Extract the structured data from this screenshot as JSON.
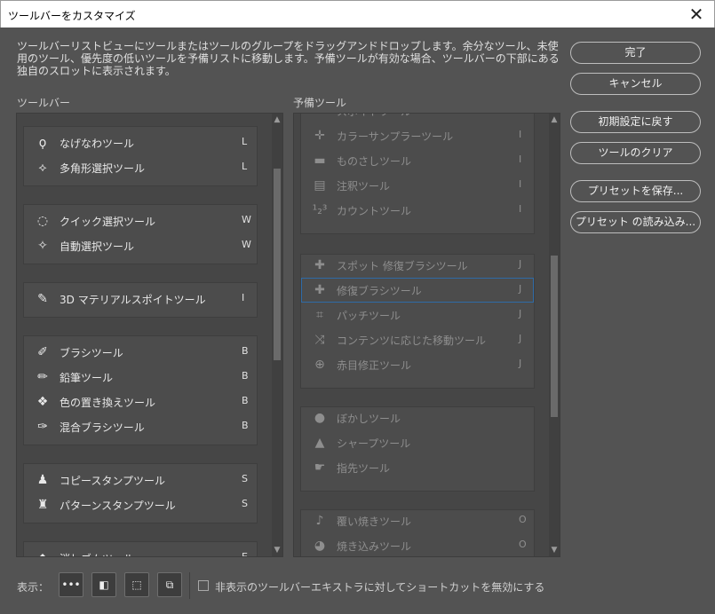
{
  "window": {
    "title": "ツールバーをカスタマイズ",
    "close_glyph": "✕"
  },
  "description": "ツールバーリストビューにツールまたはツールのグループをドラッグアンドドロップします。余分なツール、未使用のツール、優先度の低いツールを予備リストに移動します。予備ツールが有効な場合、ツールバーの下部にある独自のスロットに表示されます。",
  "buttons": {
    "done": "完了",
    "cancel": "キャンセル",
    "reset": "初期設定に戻す",
    "clear": "ツールのクリア",
    "save_preset": "プリセットを保存...",
    "load_preset": "プリセット の読み込み..."
  },
  "toolbar": {
    "label": "ツールバー",
    "groups": [
      {
        "items": [
          {
            "icon": "lasso-icon",
            "glyph": "ϙ",
            "name": "なげなわツール",
            "key": "L"
          },
          {
            "icon": "polygon-lasso-icon",
            "glyph": "⟡",
            "name": "多角形選択ツール",
            "key": "L"
          }
        ]
      },
      {
        "items": [
          {
            "icon": "quick-select-icon",
            "glyph": "◌",
            "name": "クイック選択ツール",
            "key": "W"
          },
          {
            "icon": "magic-wand-icon",
            "glyph": "✧",
            "name": "自動選択ツール",
            "key": "W"
          }
        ]
      },
      {
        "items": [
          {
            "icon": "3d-eyedropper-icon",
            "glyph": "✎",
            "name": "3D マテリアルスポイトツール",
            "key": "I"
          }
        ]
      },
      {
        "items": [
          {
            "icon": "brush-icon",
            "glyph": "✐",
            "name": "ブラシツール",
            "key": "B"
          },
          {
            "icon": "pencil-icon",
            "glyph": "✏",
            "name": "鉛筆ツール",
            "key": "B"
          },
          {
            "icon": "color-replace-icon",
            "glyph": "❖",
            "name": "色の置き換えツール",
            "key": "B"
          },
          {
            "icon": "mixer-brush-icon",
            "glyph": "✑",
            "name": "混合ブラシツール",
            "key": "B"
          }
        ]
      },
      {
        "items": [
          {
            "icon": "clone-stamp-icon",
            "glyph": "♟",
            "name": "コピースタンプツール",
            "key": "S"
          },
          {
            "icon": "pattern-stamp-icon",
            "glyph": "♜",
            "name": "パターンスタンプツール",
            "key": "S"
          }
        ]
      },
      {
        "items": [
          {
            "icon": "eraser-icon",
            "glyph": "◆",
            "name": "消しゴムツール",
            "key": "E"
          }
        ]
      }
    ]
  },
  "reserve": {
    "label": "予備ツール",
    "groups": [
      {
        "items": [
          {
            "icon": "eyedropper-icon",
            "glyph": "✎",
            "name": "スポイトツール",
            "key": "I"
          },
          {
            "icon": "color-sampler-icon",
            "glyph": "✛",
            "name": "カラーサンプラーツール",
            "key": "I"
          },
          {
            "icon": "ruler-icon",
            "glyph": "▬",
            "name": "ものさしツール",
            "key": "I"
          },
          {
            "icon": "note-icon",
            "glyph": "▤",
            "name": "注釈ツール",
            "key": "I"
          },
          {
            "icon": "count-icon",
            "glyph": "¹₂³",
            "name": "カウントツール",
            "key": "I"
          }
        ]
      },
      {
        "items": [
          {
            "icon": "spot-healing-icon",
            "glyph": "✚",
            "name": "スポット 修復ブラシツール",
            "key": "J"
          },
          {
            "icon": "healing-brush-icon",
            "glyph": "✚",
            "name": "修復ブラシツール",
            "key": "J"
          },
          {
            "icon": "patch-icon",
            "glyph": "⌗",
            "name": "パッチツール",
            "key": "J"
          },
          {
            "icon": "content-aware-move-icon",
            "glyph": "⤨",
            "name": "コンテンツに応じた移動ツール",
            "key": "J"
          },
          {
            "icon": "red-eye-icon",
            "glyph": "⊕",
            "name": "赤目修正ツール",
            "key": "J"
          }
        ]
      },
      {
        "items": [
          {
            "icon": "blur-icon",
            "glyph": "●",
            "name": "ぼかしツール",
            "key": ""
          },
          {
            "icon": "sharpen-icon",
            "glyph": "▲",
            "name": "シャープツール",
            "key": ""
          },
          {
            "icon": "smudge-icon",
            "glyph": "☛",
            "name": "指先ツール",
            "key": ""
          }
        ]
      },
      {
        "items": [
          {
            "icon": "dodge-icon",
            "glyph": "♪",
            "name": "覆い焼きツール",
            "key": "O"
          },
          {
            "icon": "burn-icon",
            "glyph": "◕",
            "name": "焼き込みツール",
            "key": "O"
          }
        ]
      }
    ]
  },
  "footer": {
    "display_label": "表示：",
    "icons": [
      {
        "icon": "more-icon",
        "glyph": "•••"
      },
      {
        "icon": "swatch-icon",
        "glyph": "◧"
      },
      {
        "icon": "quick-mask-icon",
        "glyph": "⬚"
      },
      {
        "icon": "screen-mode-icon",
        "glyph": "⧉"
      }
    ],
    "checkbox_label": "非表示のツールバーエキストラに対してショートカットを無効にする"
  }
}
